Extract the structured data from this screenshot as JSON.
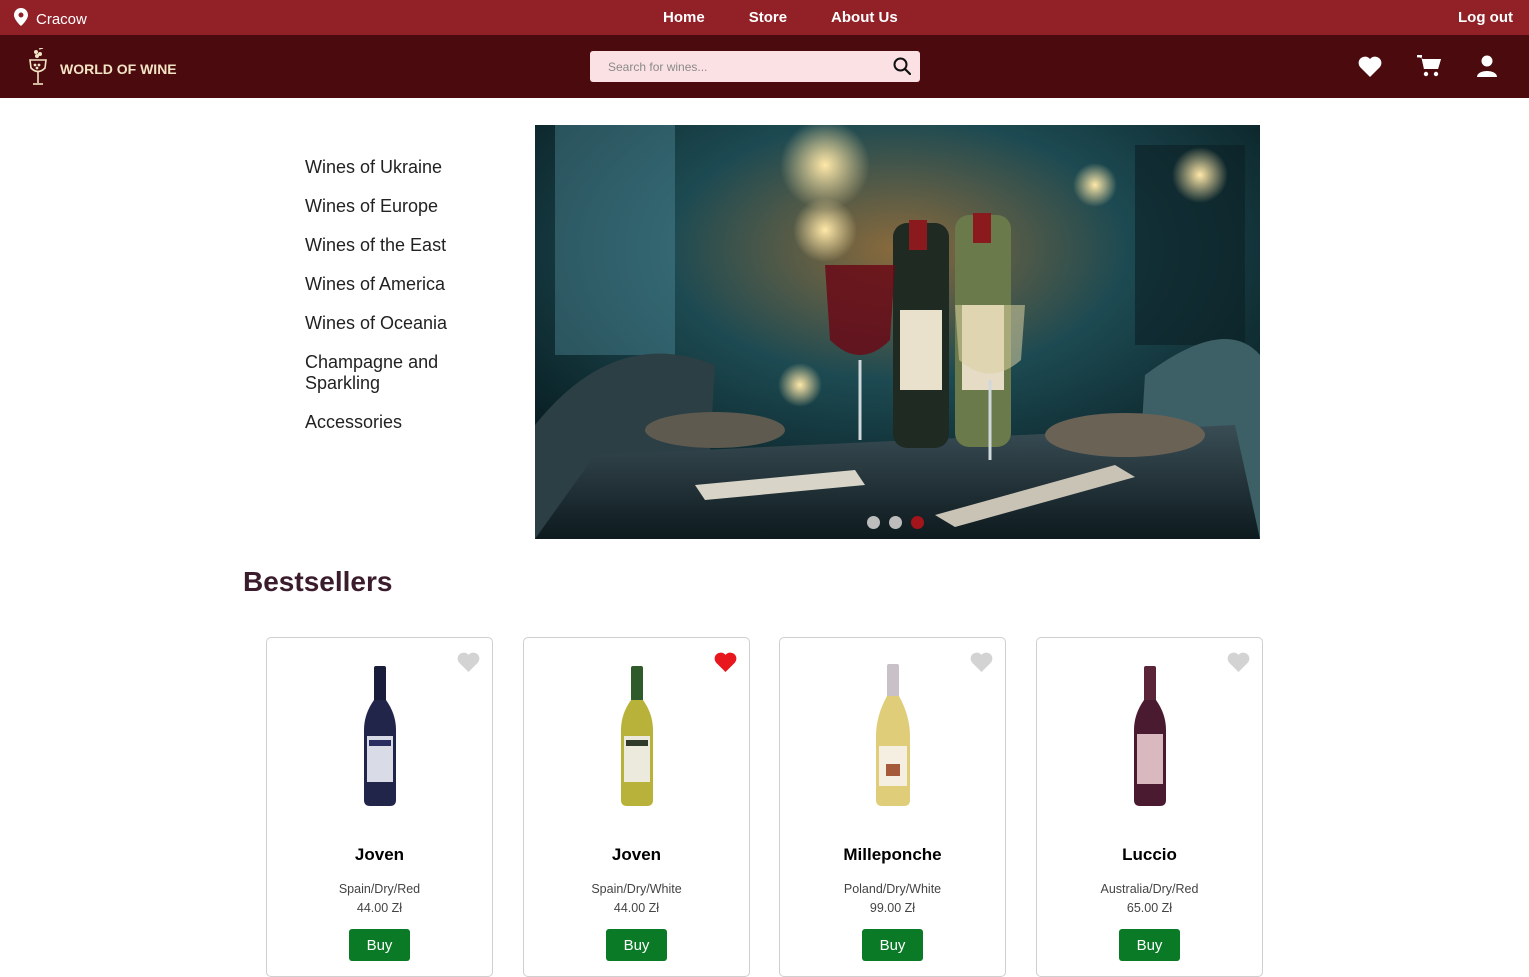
{
  "topbar": {
    "location": "Cracow",
    "nav": [
      "Home",
      "Store",
      "About Us"
    ],
    "logout": "Log out"
  },
  "header": {
    "logo_text": "WORLD OF WINE",
    "search_placeholder": "Search for wines..."
  },
  "categories": [
    "Wines of Ukraine",
    "Wines of Europe",
    "Wines of the East",
    "Wines of America",
    "Wines of Oceania",
    "Champagne and Sparkling",
    "Accessories"
  ],
  "carousel": {
    "slide_count": 3,
    "active_slide": 3
  },
  "bestsellers": {
    "title": "Bestsellers",
    "products": [
      {
        "name": "Joven",
        "info": "Spain/Dry/Red",
        "price": "44.00 Zł",
        "buy": "Buy",
        "favorite": false
      },
      {
        "name": "Joven",
        "info": "Spain/Dry/White",
        "price": "44.00 Zł",
        "buy": "Buy",
        "favorite": true
      },
      {
        "name": "Milleponche",
        "info": "Poland/Dry/White",
        "price": "99.00 Zł",
        "buy": "Buy",
        "favorite": false
      },
      {
        "name": "Luccio",
        "info": "Australia/Dry/Red",
        "price": "65.00 Zł",
        "buy": "Buy",
        "favorite": false
      }
    ]
  },
  "colors": {
    "topbar": "#912127",
    "header": "#4b0a0d",
    "buy": "#0a7a27",
    "favorite_active": "#e8161d",
    "favorite_inactive": "#d3d3d3"
  }
}
